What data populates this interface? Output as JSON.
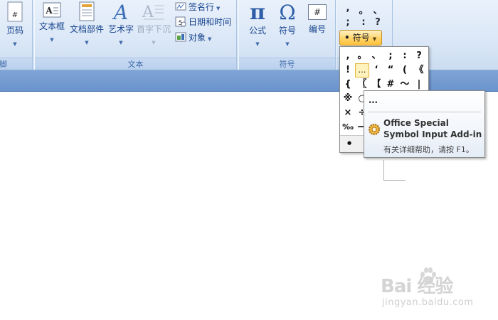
{
  "ribbon": {
    "groups": {
      "header_footer": {
        "label": "脚",
        "page_number_label": "页码"
      },
      "text": {
        "label": "文本",
        "textbox_label": "文本框",
        "quickparts_label": "文档部件",
        "wordart_label": "艺术字",
        "dropcap_label": "首字下沉",
        "signature_label": "签名行",
        "datetime_label": "日期和时间",
        "object_label": "对象"
      },
      "symbols": {
        "label": "符号",
        "equation_label": "公式",
        "symbol_label": "符号",
        "number_label": "编号",
        "equation_glyph": "π",
        "symbol_glyph": "Ω",
        "number_glyph": "#"
      }
    },
    "symbol_quick": {
      "row1": [
        ",",
        "。",
        "、"
      ],
      "row2": [
        ";",
        ":",
        "?"
      ],
      "button_label": "符号",
      "button_glyph": "•"
    }
  },
  "symbol_grid": {
    "rows": [
      [
        ",",
        "。",
        "、",
        ";",
        ":",
        "?"
      ],
      [
        "!",
        "…",
        "‘",
        "“",
        "(",
        "《"
      ],
      [
        "{",
        "〖",
        "【",
        "#",
        "～",
        "|"
      ],
      [
        "※",
        "○",
        "",
        "",
        "",
        ""
      ],
      [
        "×",
        "÷",
        "",
        "",
        "",
        ""
      ],
      [
        "‰",
        "—",
        "",
        "",
        "",
        ""
      ],
      [
        "•",
        "",
        "",
        "",
        "",
        ""
      ]
    ]
  },
  "tooltip": {
    "title": "…",
    "heading": "Office Special Symbol Input Add-in",
    "help": "有关详细帮助，请按 F1。",
    "icon": "gear-icon"
  },
  "watermark": {
    "logo": "Bai 经验",
    "site": "jingyan.baidu.com"
  },
  "colors": {
    "ribbon_text": "#15428b",
    "selected_button": "#ffd46a",
    "strip": "#6b93cd"
  }
}
